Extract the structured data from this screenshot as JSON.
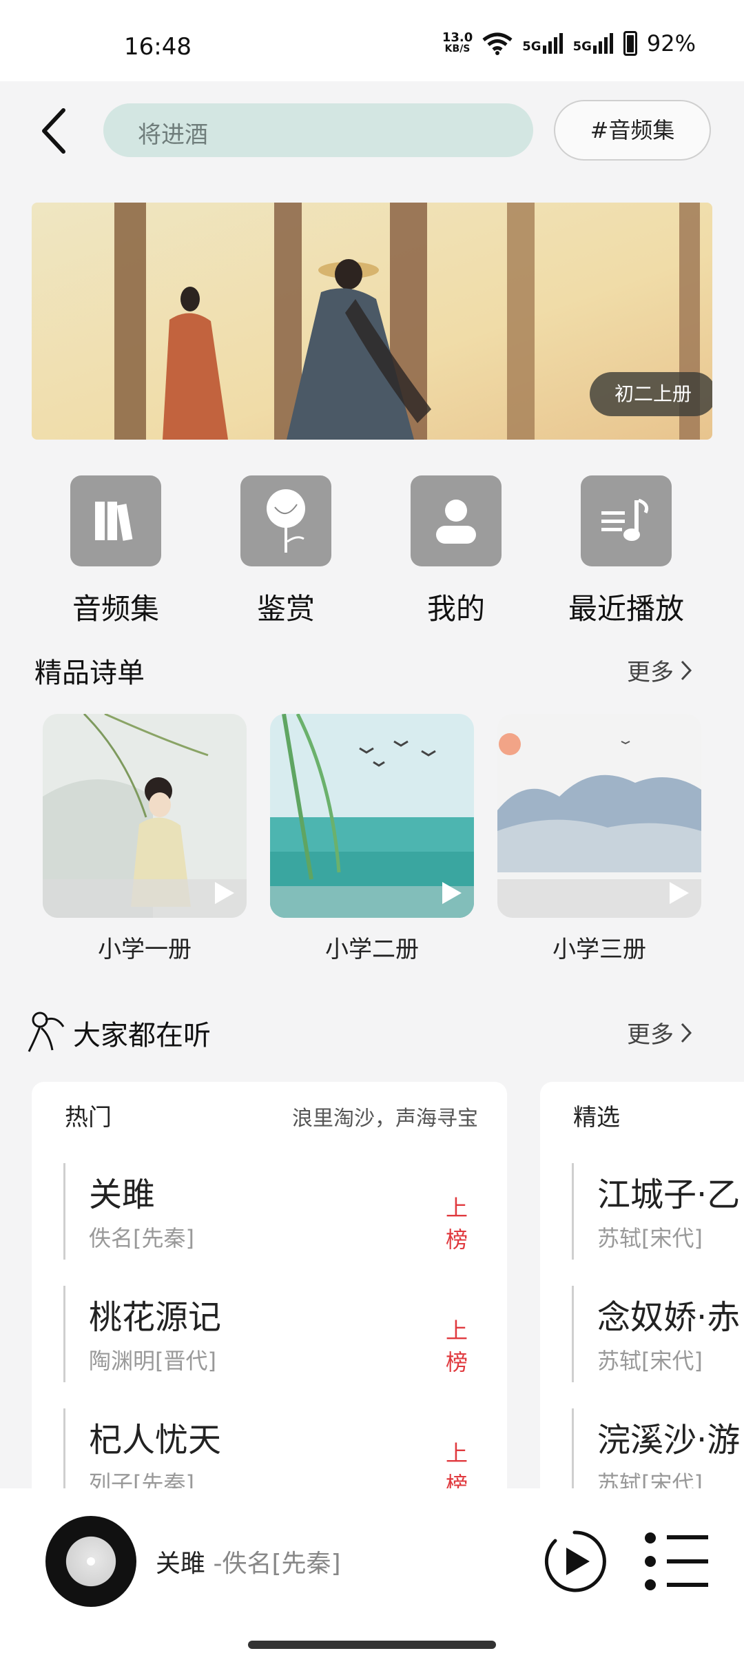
{
  "status_bar": {
    "time": "16:48",
    "net_speed_top": "13.0",
    "net_speed_unit": "KB/S",
    "signal1": "5G",
    "signal2": "5G",
    "battery": "92%"
  },
  "header": {
    "search_value": "将进酒",
    "tag_button": "#音频集"
  },
  "banner": {
    "badge": "初二上册"
  },
  "quick_nav": [
    {
      "label": "音频集",
      "icon": "books-icon"
    },
    {
      "label": "鉴赏",
      "icon": "flower-icon"
    },
    {
      "label": "我的",
      "icon": "user-icon"
    },
    {
      "label": "最近播放",
      "icon": "playlist-music-icon"
    }
  ],
  "featured": {
    "title": "精品诗单",
    "more": "更多",
    "items": [
      {
        "label": "小学一册"
      },
      {
        "label": "小学二册"
      },
      {
        "label": "小学三册"
      }
    ]
  },
  "listening": {
    "title": "大家都在听",
    "more": "更多",
    "hot": {
      "title": "热门",
      "slogan": "浪里淘沙，声海寻宝",
      "songs": [
        {
          "title": "关雎",
          "author": "佚名[先秦]",
          "rank": "上榜"
        },
        {
          "title": "桃花源记",
          "author": "陶渊明[晋代]",
          "rank": "上榜"
        },
        {
          "title": "杞人忧天",
          "author": "列子[先秦]",
          "rank": "上榜"
        }
      ]
    },
    "picked": {
      "title": "精选",
      "songs": [
        {
          "title": "江城子·乙",
          "author": "苏轼[宋代]"
        },
        {
          "title": "念奴娇·赤",
          "author": "苏轼[宋代]"
        },
        {
          "title": "浣溪沙·游",
          "author": "苏轼[宋代]"
        }
      ]
    }
  },
  "player": {
    "song": "关雎",
    "artist": "-佚名[先秦]"
  }
}
